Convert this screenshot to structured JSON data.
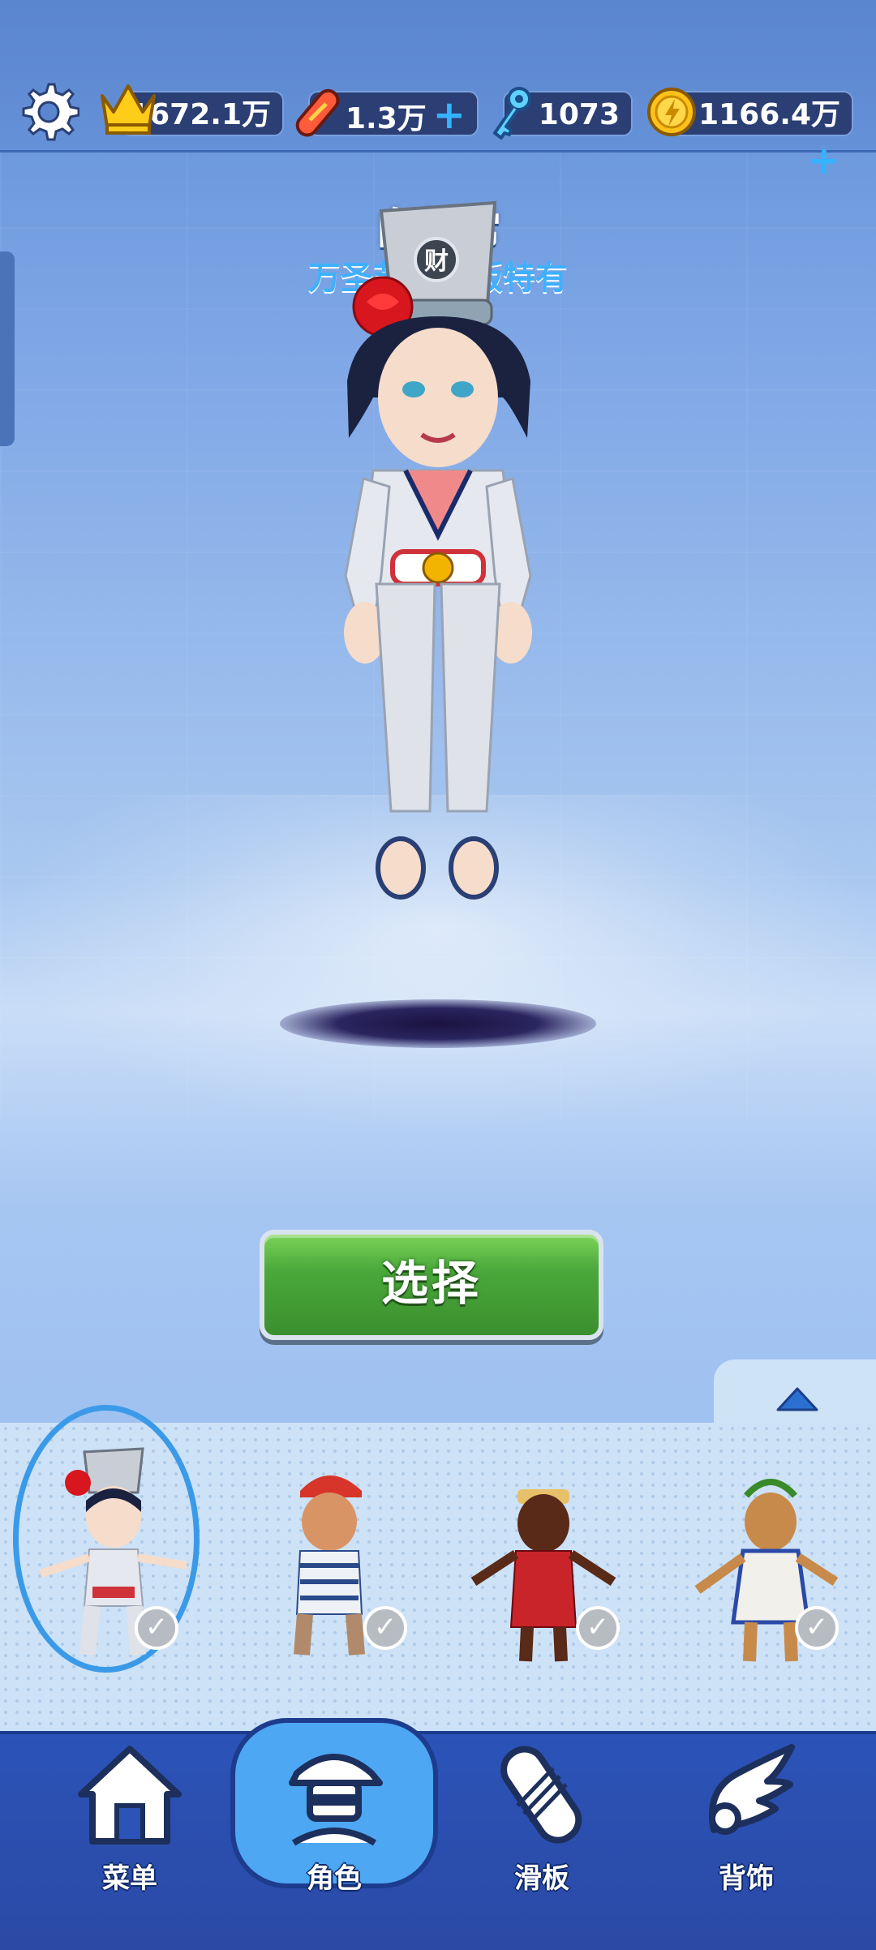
{
  "top_bar": {
    "settings_icon": "gear-icon",
    "crowns": {
      "icon": "crown-icon",
      "value": "1672.1万"
    },
    "boards": {
      "icon": "hoverboard-icon",
      "value": "1.3万",
      "plus": "+"
    },
    "keys": {
      "icon": "key-icon",
      "value": "1073"
    },
    "coins": {
      "icon": "coin-icon",
      "value": "1166.4万",
      "plus": "+"
    }
  },
  "character": {
    "name": "白無常",
    "subtitle": "万圣节特别版特有"
  },
  "select_button": {
    "label": "选择"
  },
  "carousel": {
    "expand_icon": "chevron-up-icon",
    "characters": [
      {
        "name": "白無常",
        "selected": true,
        "owned": true
      },
      {
        "name": "character-2",
        "selected": false,
        "owned": true
      },
      {
        "name": "character-3",
        "selected": false,
        "owned": true
      },
      {
        "name": "character-4",
        "selected": false,
        "owned": true
      }
    ],
    "check_glyph": "✓"
  },
  "nav": {
    "items": [
      {
        "label": "菜单",
        "icon": "home-icon",
        "active": false
      },
      {
        "label": "角色",
        "icon": "character-icon",
        "active": true
      },
      {
        "label": "滑板",
        "icon": "skateboard-icon",
        "active": false
      },
      {
        "label": "背饰",
        "icon": "wings-icon",
        "active": false
      }
    ]
  },
  "colors": {
    "accent_blue": "#3b9ae8",
    "select_green": "#4aa93a",
    "nav_blue": "#2b53b8",
    "subtitle_blue": "#3fb0ff"
  }
}
